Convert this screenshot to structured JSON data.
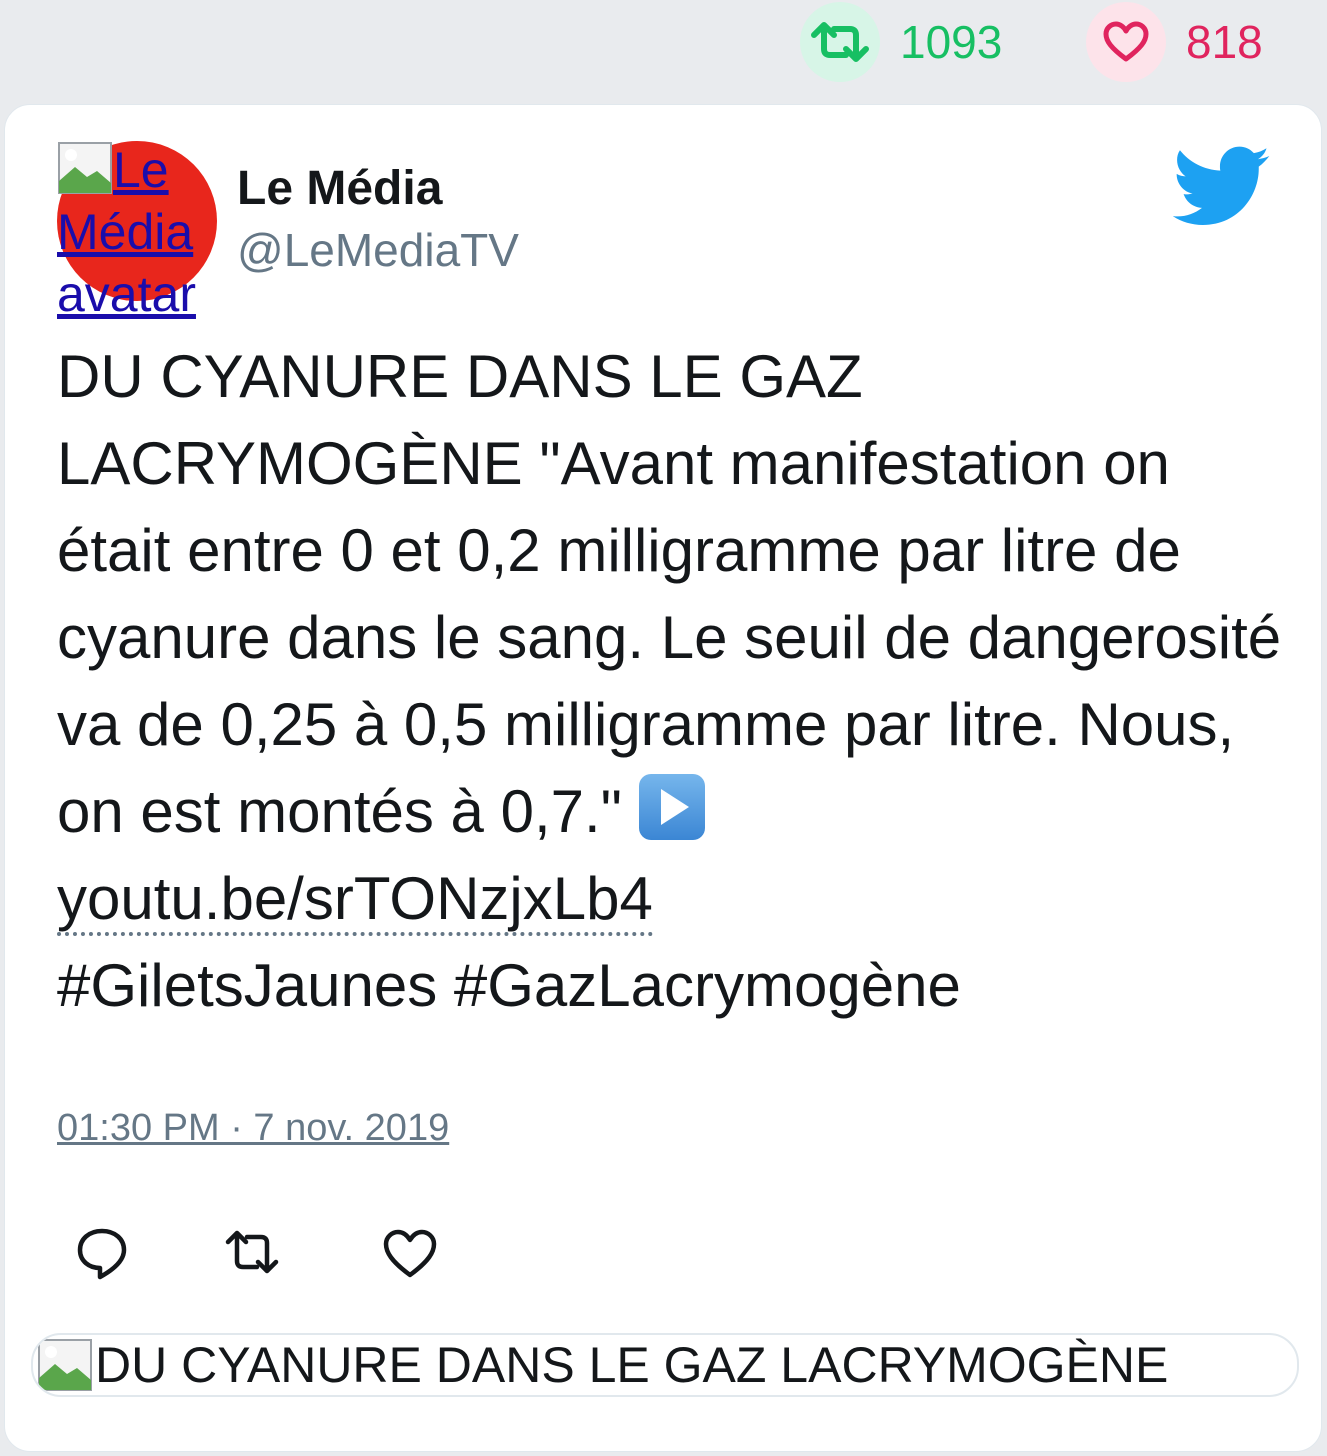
{
  "stats": {
    "retweets": "1093",
    "likes": "818"
  },
  "tweet": {
    "author": {
      "name": "Le Média",
      "handle": "@LeMediaTV",
      "avatar_alt_line1": "Le",
      "avatar_alt_line2": "Média",
      "avatar_alt_line3": "avatar"
    },
    "text_before_emoji": "DU CYANURE DANS LE GAZ LACRYMOGÈNE \"Avant manifestation on était entre 0 et 0,2 milligramme par litre de cyanure dans le sang. Le seuil de dangerosité va de 0,25 à 0,5 milligramme par litre. Nous, on est montés à 0,7.\"",
    "link": "youtu.be/srTONzjxLb4",
    "hashtags": "#GiletsJaunes #GazLacrymogène",
    "timestamp": "01:30 PM · 7 nov. 2019",
    "media_alt": "DU CYANURE DANS LE GAZ LACRYMOGÈNE"
  },
  "colors": {
    "retweet": "#17bf63",
    "like": "#e0245e",
    "twitter_blue": "#1da1f2",
    "avatar_red": "#e8261c",
    "secondary_text": "#657786"
  },
  "icons": {
    "retweet_stat": "retweet-icon",
    "like_stat": "heart-icon",
    "brand": "twitter-bird-icon",
    "emoji": "play-button-emoji",
    "actions": [
      "reply-icon",
      "retweet-icon",
      "heart-icon"
    ]
  }
}
